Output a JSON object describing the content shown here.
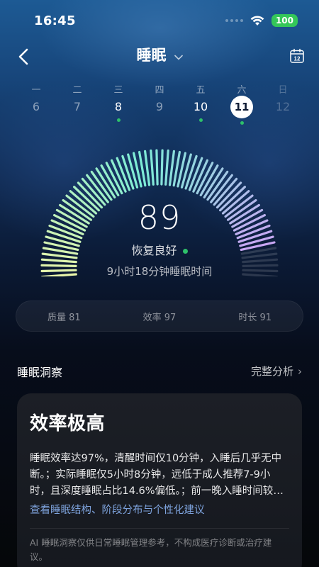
{
  "status_bar": {
    "time": "16:45",
    "battery": "100"
  },
  "header": {
    "title": "睡眠"
  },
  "week": [
    {
      "weekday": "一",
      "date": "6",
      "dot": false,
      "style": "normal"
    },
    {
      "weekday": "二",
      "date": "7",
      "dot": false,
      "style": "normal"
    },
    {
      "weekday": "三",
      "date": "8",
      "dot": true,
      "style": "strong"
    },
    {
      "weekday": "四",
      "date": "9",
      "dot": false,
      "style": "normal"
    },
    {
      "weekday": "五",
      "date": "10",
      "dot": true,
      "style": "strong"
    },
    {
      "weekday": "六",
      "date": "11",
      "dot": true,
      "style": "selected"
    },
    {
      "weekday": "日",
      "date": "12",
      "dot": false,
      "style": "faded"
    }
  ],
  "calendar_icon_day": "12",
  "gauge": {
    "score": "89",
    "score_max": 100,
    "status": "恢复良好",
    "duration": "9小时18分钟睡眠时间",
    "colors": {
      "start": "#f0f5a6",
      "mid": "#7cecd6",
      "end": "#c8a6f3"
    }
  },
  "metrics": [
    "质量 81",
    "效率 97",
    "时长 91"
  ],
  "insight": {
    "section_title": "睡眠洞察",
    "section_link": "完整分析",
    "card_title": "效率极高",
    "card_body": "睡眠效率达97%，清醒时间仅10分钟，入睡后几乎无中断。；实际睡眠仅5小时8分钟，远低于成人推荐7-9小时，且深度睡眠占比14.6%偏低。；前一晚入睡时间较晚，建议尽早上床休息。",
    "card_link": "查看睡眠结构、阶段分布与个性化建议",
    "disclaimer": "AI 睡眠洞察仅供日常睡眠管理参考，不构成医疗诊断或治疗建议。"
  },
  "colors": {
    "accent_green": "#2ec06a",
    "link_blue": "#7ea3dd",
    "battery_green": "#34c759"
  },
  "icons": [
    "wifi-icon",
    "back-chevron-icon",
    "dropdown-chevron-icon",
    "calendar-icon"
  ]
}
